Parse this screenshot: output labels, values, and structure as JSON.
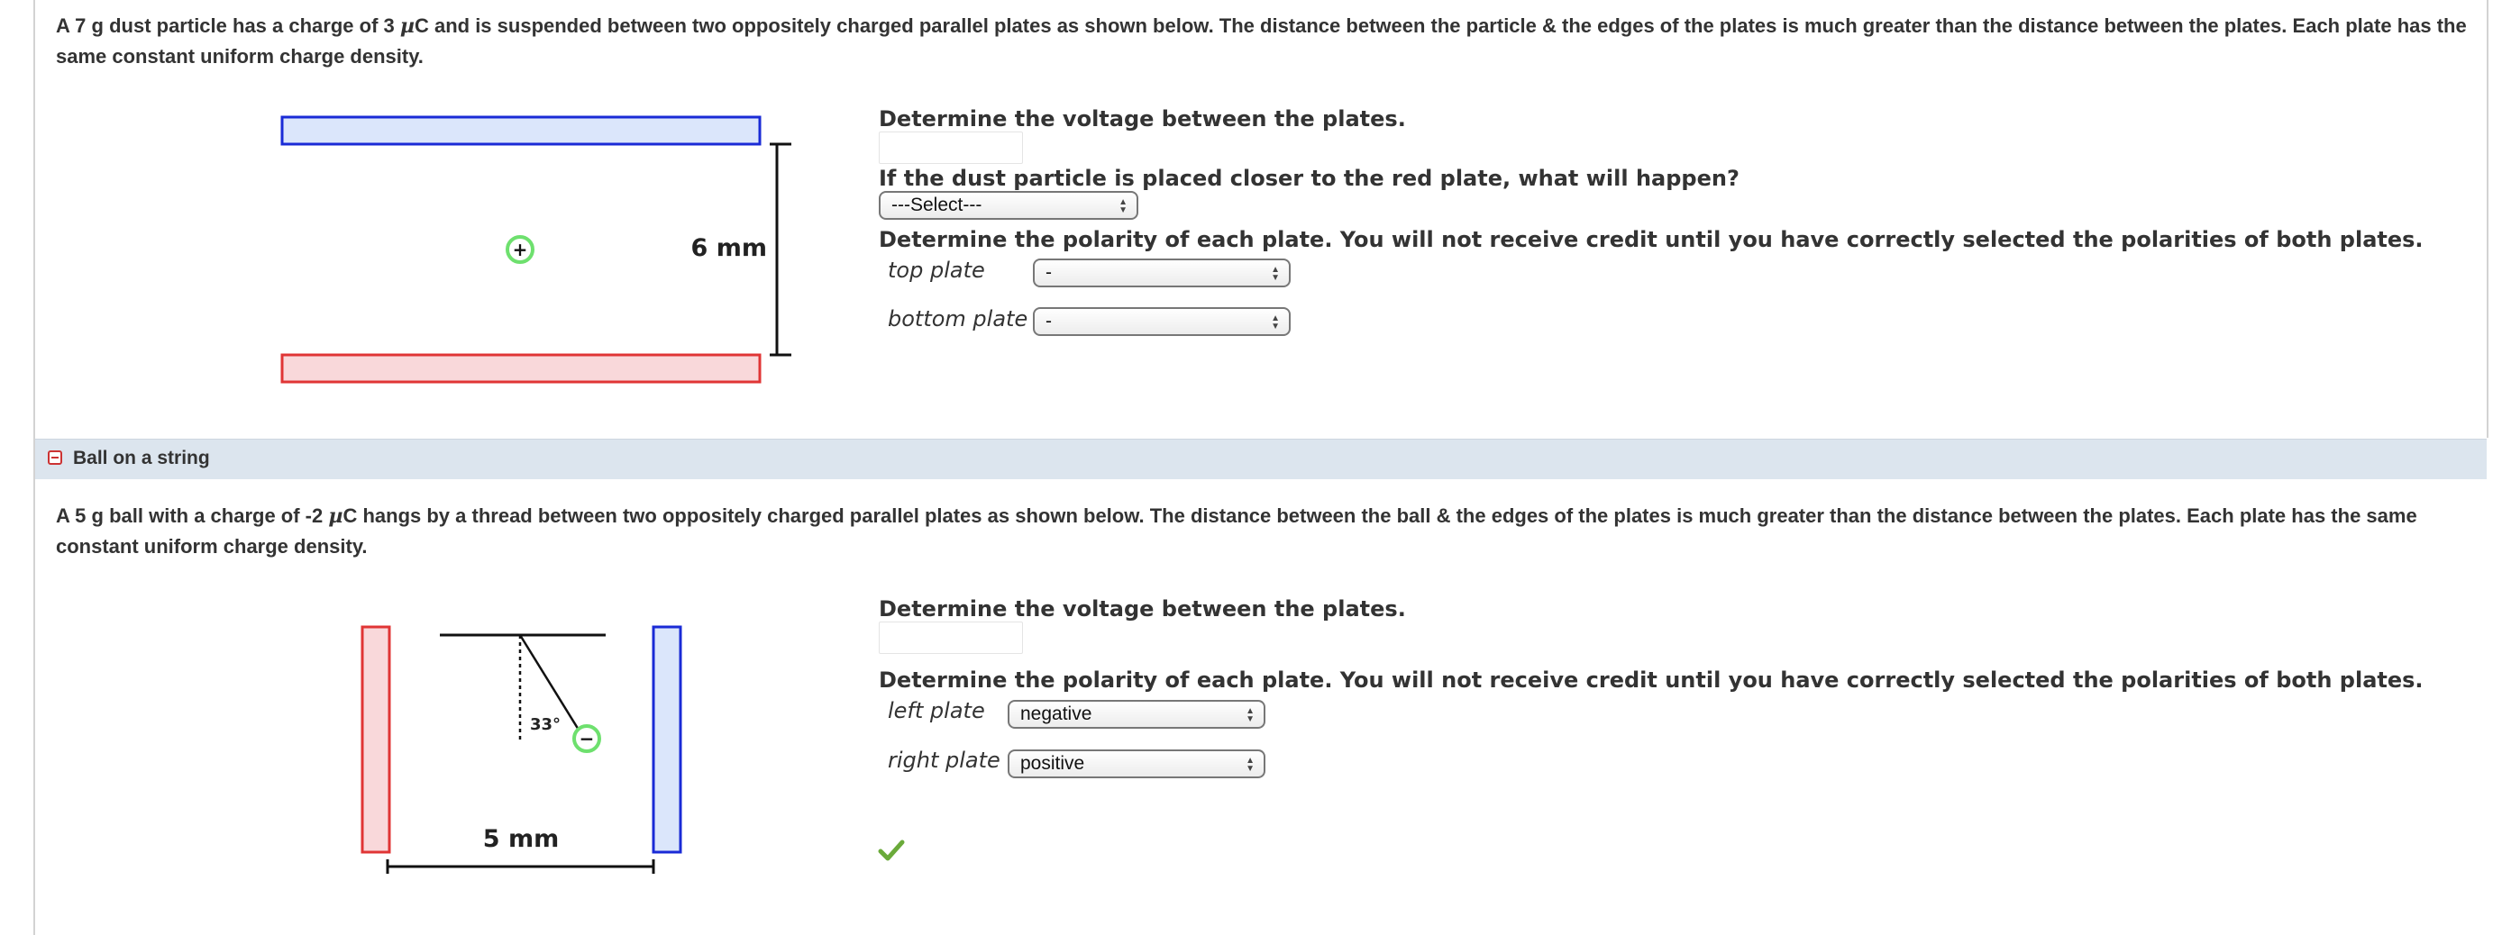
{
  "problem1": {
    "text_part1": "A 7 g dust particle has a charge of 3 ",
    "mu": "µ",
    "text_part2": "C and is suspended between two oppositely charged parallel plates as shown below. The distance between the particle & the edges of the plates is much greater than the distance between the plates. Each plate has the same constant uniform charge density.",
    "figure": {
      "distance_label": "6 mm",
      "particle_sign": "+"
    },
    "q_voltage": "Determine the voltage between the plates.",
    "q_closer": "If the dust particle is placed closer to the red plate, what will happen?",
    "closer_select": "---Select---",
    "q_polarity": "Determine the polarity of each plate. You will not receive credit until you have correctly selected the polarities of both plates.",
    "top_plate_label": "top plate",
    "top_plate_value": "-",
    "bottom_plate_label": "bottom plate",
    "bottom_plate_value": "-"
  },
  "section": {
    "title": "Ball on a string"
  },
  "problem2": {
    "text_part1": "A 5 g ball with a charge of -2 ",
    "mu": "µ",
    "text_part2": "C hangs by a thread between two oppositely charged parallel plates as shown below. The distance between the ball & the edges of the plates is much greater than the distance between the plates. Each plate has the same constant uniform charge density.",
    "figure": {
      "distance_label": "5 mm",
      "angle_label": "33°",
      "ball_sign": "−"
    },
    "q_voltage": "Determine the voltage between the plates.",
    "q_polarity": "Determine the polarity of each plate. You will not receive credit until you have correctly selected the polarities of both plates.",
    "left_plate_label": "left plate",
    "left_plate_value": "negative",
    "right_plate_label": "right plate",
    "right_plate_value": "positive",
    "status_icon": "check-icon"
  },
  "colors": {
    "blue_plate_stroke": "#1a2bd6",
    "blue_plate_fill": "#dbe6fb",
    "red_plate_stroke": "#e03535",
    "red_plate_fill": "#f9d8da",
    "charge_ring": "#6ee06e",
    "check": "#6aaa3a"
  }
}
